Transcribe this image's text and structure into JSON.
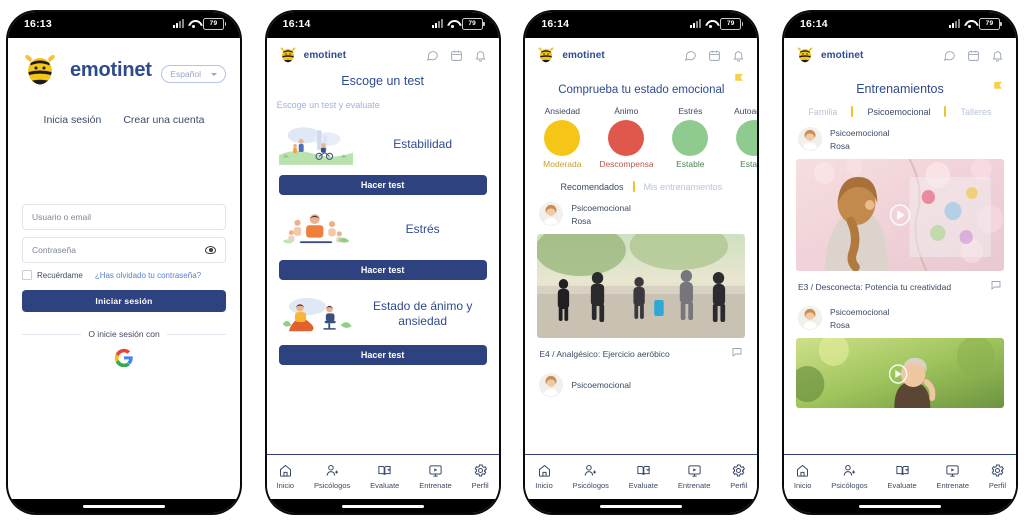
{
  "theme": {
    "navy": "#2f4280",
    "brand_blue": "#2e4b8f",
    "muted_blue": "#9fb3dd",
    "yellow": "#f2c230",
    "mood_yellow": "#f5c518",
    "mood_red": "#e0584c",
    "mood_green": "#8fcb8f"
  },
  "screens": [
    {
      "id": "login",
      "status": {
        "time": "16:13",
        "battery": "79"
      },
      "brand": "emotinet",
      "language_selector": {
        "value": "Español"
      },
      "tabs": [
        {
          "label": "Inicia sesión"
        },
        {
          "label": "Crear una cuenta"
        }
      ],
      "form": {
        "user_placeholder": "Usuario o email",
        "password_placeholder": "Contraseña",
        "remember_label": "Recuérdame",
        "forgot_label": "¿Has olvidado tu contraseña?",
        "submit_label": "Iniciar sesión"
      },
      "divider_label": "O inicie sesión con",
      "social": {
        "google": "G"
      }
    },
    {
      "id": "tests",
      "status": {
        "time": "16:14",
        "battery": "79"
      },
      "brand": "emotinet",
      "title": "Escoge un test",
      "subtitle": "Escoge un test y evaluate",
      "tests": [
        {
          "name": "Estabilidad",
          "button": "Hacer test"
        },
        {
          "name": "Estrés",
          "button": "Hacer test"
        },
        {
          "name": "Estado de ánimo y ansiedad",
          "button": "Hacer test"
        }
      ]
    },
    {
      "id": "emotional-status",
      "status": {
        "time": "16:14",
        "battery": "79"
      },
      "brand": "emotinet",
      "title": "Comprueba tu estado emocional",
      "moods": [
        {
          "name": "Ansiedad",
          "value": "Moderada",
          "color": "#f5c518",
          "value_color": "#c9a227"
        },
        {
          "name": "Ánimo",
          "value": "Descompensado",
          "color": "#e0584c",
          "value_color": "#c0564c"
        },
        {
          "name": "Estrés",
          "value": "Estable",
          "color": "#8fcb8f",
          "value_color": "#4a7f52"
        },
        {
          "name": "Autoacept.",
          "value": "Estable",
          "color": "#8fcb8f",
          "value_color": "#4a7f52"
        }
      ],
      "subtabs": [
        {
          "label": "Recomendados",
          "active": true
        },
        {
          "label": "Mis entrenamientos",
          "active": false
        }
      ],
      "feed": [
        {
          "category": "Psicoemocional",
          "author": "Rosa",
          "caption": "E4 / Analgésico: Ejercicio aeróbico"
        },
        {
          "category": "Psicoemocional",
          "author": "",
          "caption": ""
        }
      ]
    },
    {
      "id": "trainings",
      "status": {
        "time": "16:14",
        "battery": "79"
      },
      "brand": "emotinet",
      "title": "Entrenamientos",
      "tabs": [
        {
          "label": "Familia",
          "active": false
        },
        {
          "label": "Psicoemocional",
          "active": true
        },
        {
          "label": "Talleres",
          "active": false
        }
      ],
      "feed": [
        {
          "category": "Psicoemocional",
          "author": "Rosa",
          "caption": "E3 / Desconecta: Potencia tu creatividad"
        },
        {
          "category": "Psicoemocional",
          "author": "Rosa",
          "caption": ""
        }
      ]
    }
  ],
  "bottom_nav": [
    {
      "label": "Inicio",
      "icon": "home-icon"
    },
    {
      "label": "Psicólogos",
      "icon": "person-add-icon"
    },
    {
      "label": "Evaluate",
      "icon": "book-icon"
    },
    {
      "label": "Entrenate",
      "icon": "monitor-play-icon"
    },
    {
      "label": "Perfil",
      "icon": "gear-icon"
    }
  ]
}
